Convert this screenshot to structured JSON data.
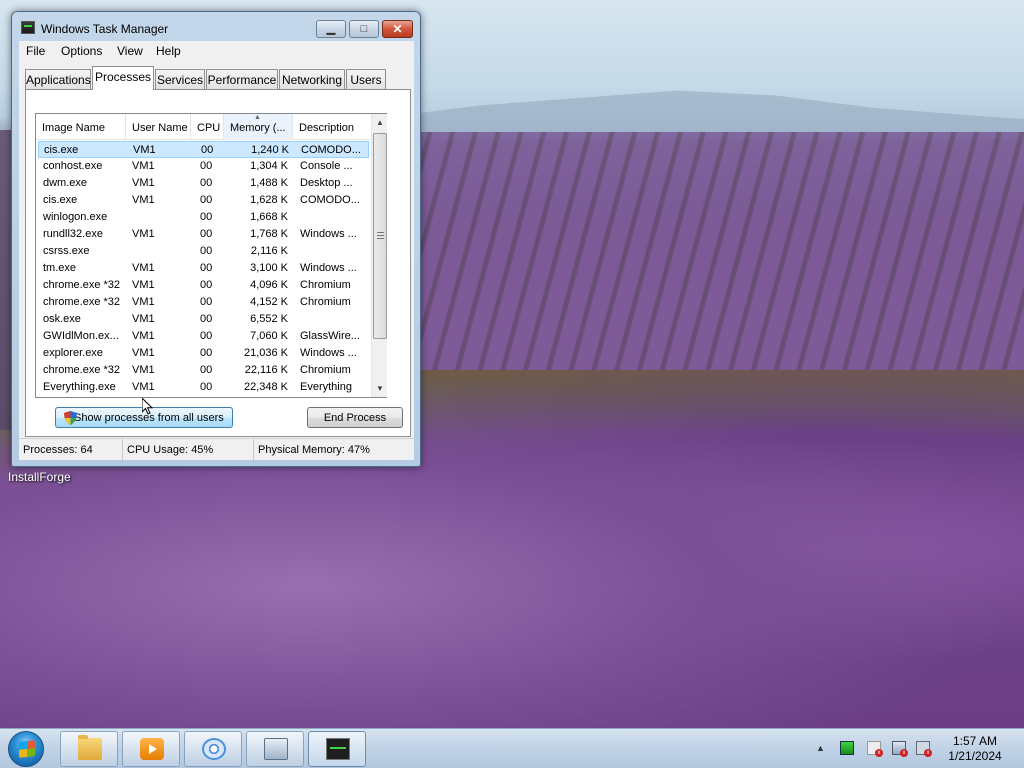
{
  "window": {
    "title": "Windows Task Manager",
    "buttons": {
      "minimize": "▁",
      "maximize": "□",
      "close": "✕"
    }
  },
  "menu": [
    "File",
    "Options",
    "View",
    "Help"
  ],
  "tabs": [
    {
      "label": "Applications",
      "active": false
    },
    {
      "label": "Processes",
      "active": true
    },
    {
      "label": "Services",
      "active": false
    },
    {
      "label": "Performance",
      "active": false
    },
    {
      "label": "Networking",
      "active": false
    },
    {
      "label": "Users",
      "active": false
    }
  ],
  "processes": {
    "columns": [
      "Image Name",
      "User Name",
      "CPU",
      "Memory (...",
      "Description"
    ],
    "sorted_column": "Memory (...",
    "rows": [
      {
        "name": "cis.exe",
        "user": "VM1",
        "cpu": "00",
        "memory": "1,240 K",
        "desc": "COMODO...",
        "selected": true
      },
      {
        "name": "conhost.exe",
        "user": "VM1",
        "cpu": "00",
        "memory": "1,304 K",
        "desc": "Console ..."
      },
      {
        "name": "dwm.exe",
        "user": "VM1",
        "cpu": "00",
        "memory": "1,488 K",
        "desc": "Desktop ..."
      },
      {
        "name": "cis.exe",
        "user": "VM1",
        "cpu": "00",
        "memory": "1,628 K",
        "desc": "COMODO..."
      },
      {
        "name": "winlogon.exe",
        "user": "",
        "cpu": "00",
        "memory": "1,668 K",
        "desc": ""
      },
      {
        "name": "rundll32.exe",
        "user": "VM1",
        "cpu": "00",
        "memory": "1,768 K",
        "desc": "Windows ..."
      },
      {
        "name": "csrss.exe",
        "user": "",
        "cpu": "00",
        "memory": "2,116 K",
        "desc": ""
      },
      {
        "name": "tm.exe",
        "user": "VM1",
        "cpu": "00",
        "memory": "3,100 K",
        "desc": "Windows ..."
      },
      {
        "name": "chrome.exe *32",
        "user": "VM1",
        "cpu": "00",
        "memory": "4,096 K",
        "desc": "Chromium"
      },
      {
        "name": "chrome.exe *32",
        "user": "VM1",
        "cpu": "00",
        "memory": "4,152 K",
        "desc": "Chromium"
      },
      {
        "name": "osk.exe",
        "user": "VM1",
        "cpu": "00",
        "memory": "6,552 K",
        "desc": ""
      },
      {
        "name": "GWIdlMon.ex...",
        "user": "VM1",
        "cpu": "00",
        "memory": "7,060 K",
        "desc": "GlassWire..."
      },
      {
        "name": "explorer.exe",
        "user": "VM1",
        "cpu": "00",
        "memory": "21,036 K",
        "desc": "Windows ..."
      },
      {
        "name": "chrome.exe *32",
        "user": "VM1",
        "cpu": "00",
        "memory": "22,116 K",
        "desc": "Chromium"
      },
      {
        "name": "Everything.exe",
        "user": "VM1",
        "cpu": "00",
        "memory": "22,348 K",
        "desc": "Everything"
      }
    ]
  },
  "buttons": {
    "show_all": "Show processes from all users",
    "end_process": "End Process"
  },
  "status": {
    "processes": "Processes: 64",
    "cpu": "CPU Usage: 45%",
    "memory": "Physical Memory: 47%"
  },
  "desktop": {
    "icon_label": "InstallForge"
  },
  "taskbar": {
    "pinned": [
      "folder-icon",
      "media-player-icon",
      "chrome-icon",
      "on-screen-keyboard-icon",
      "task-manager-icon"
    ],
    "clock_time": "1:57 AM",
    "clock_date": "1/21/2024"
  }
}
